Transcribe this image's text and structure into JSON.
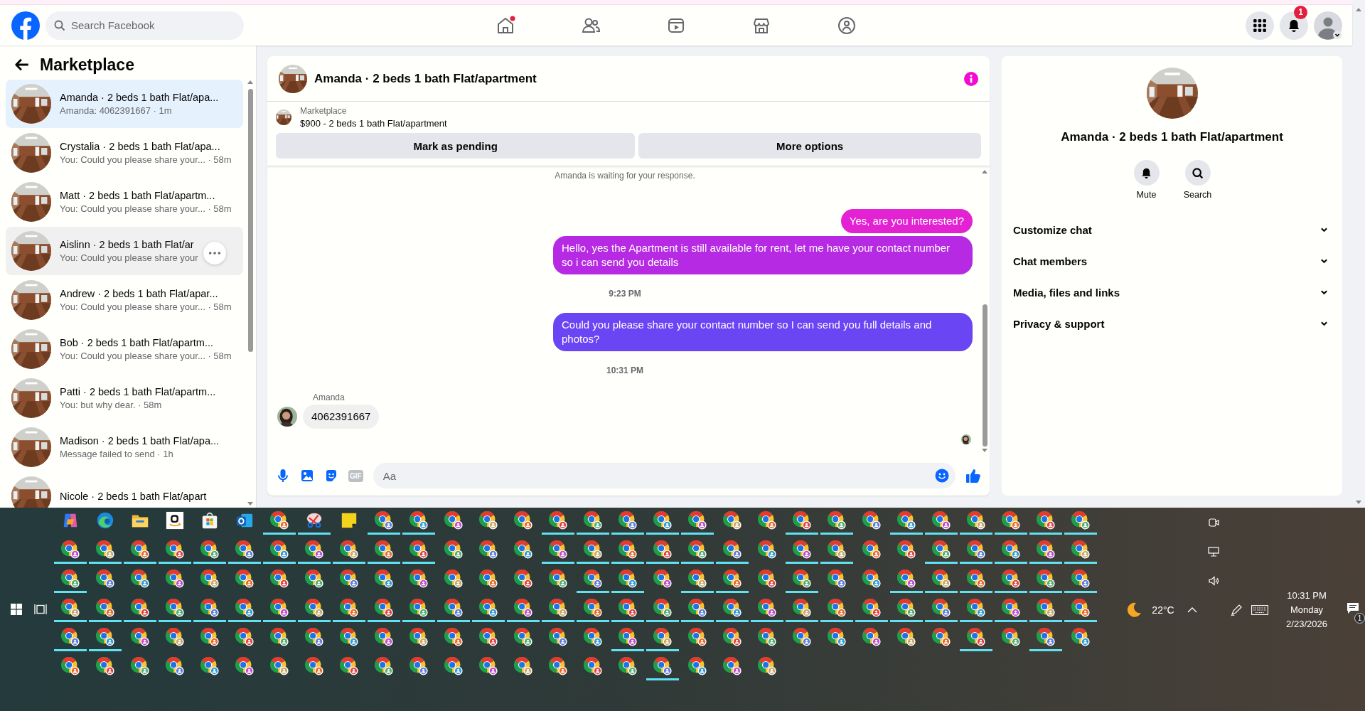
{
  "top_bar": {
    "search": {
      "placeholder": "Search Facebook"
    },
    "notification_badge": "1"
  },
  "sidebar": {
    "title": "Marketplace",
    "conversations": [
      {
        "title": "Amanda · 2 beds 1 bath Flat/apa...",
        "subtitle": "Amanda: 4062391667 · 1m",
        "selected": true,
        "hovered": false
      },
      {
        "title": "Crystalia · 2 beds 1 bath Flat/apa...",
        "subtitle": "You: Could you please share your... · 58m",
        "selected": false,
        "hovered": false
      },
      {
        "title": "Matt · 2 beds 1 bath Flat/apartm...",
        "subtitle": "You: Could you please share your... · 58m",
        "selected": false,
        "hovered": false
      },
      {
        "title": "Aislinn · 2 beds 1 bath Flat/ar",
        "subtitle": "You: Could you please share your",
        "selected": false,
        "hovered": true
      },
      {
        "title": "Andrew · 2 beds 1 bath Flat/apar...",
        "subtitle": "You: Could you please share your... · 58m",
        "selected": false,
        "hovered": false
      },
      {
        "title": "Bob · 2 beds 1 bath Flat/apartm...",
        "subtitle": "You: Could you please share your... · 58m",
        "selected": false,
        "hovered": false
      },
      {
        "title": "Patti · 2 beds 1 bath Flat/apartm...",
        "subtitle": "You: but why dear. · 58m",
        "selected": false,
        "hovered": false
      },
      {
        "title": "Madison · 2 beds 1 bath Flat/apa...",
        "subtitle": "Message failed to send · 1h",
        "selected": false,
        "hovered": false
      },
      {
        "title": "Nicole · 2 beds 1 bath Flat/apart",
        "selected": false,
        "hovered": false
      }
    ]
  },
  "chat": {
    "title": "Amanda · 2 beds 1 bath Flat/apartment",
    "listing": {
      "label": "Marketplace",
      "title": "$900 - 2 beds 1 bath Flat/apartment"
    },
    "buttons": [
      "Mark as pending",
      "More options"
    ],
    "messages": [
      {
        "kind": "system",
        "text": "Amanda is waiting for your response."
      },
      {
        "kind": "outgoing",
        "text": "Yes, are you interested?",
        "color": "#e322d3"
      },
      {
        "kind": "outgoing",
        "text": "Hello, yes the Apartment is still available for rent, let me have your contact number so i can send you details",
        "color": "#b72ae4"
      },
      {
        "kind": "time",
        "text": "9:23 PM"
      },
      {
        "kind": "outgoing",
        "text": "Could you please share your contact number so I can send you full details and photos?",
        "color": "#6945f4"
      },
      {
        "kind": "time",
        "text": "10:31 PM"
      },
      {
        "kind": "incoming",
        "sender": "Amanda",
        "text": "4062391667"
      }
    ],
    "composer": {
      "gif": "GIF",
      "placeholder": "Aa"
    }
  },
  "info": {
    "title": "Amanda · 2 beds 1 bath Flat/apartment",
    "actions": [
      {
        "kind": "bell",
        "label": "Mute"
      },
      {
        "kind": "search",
        "label": "Search"
      }
    ],
    "sections": [
      {
        "label": "Customize chat",
        "expanded": false
      },
      {
        "label": "Chat members",
        "expanded": false
      },
      {
        "label": "Media, files and links",
        "expanded": false
      },
      {
        "label": "Privacy & support",
        "expanded": false
      }
    ]
  },
  "taskbar": {
    "rows": [
      [
        {
          "kind": "copilot",
          "running": false
        },
        {
          "kind": "edge",
          "running": false
        },
        {
          "kind": "explorer",
          "running": false
        },
        {
          "kind": "amazon",
          "running": false
        },
        {
          "kind": "store",
          "running": false
        },
        {
          "kind": "outlook",
          "running": false
        },
        {
          "kind": "chrome",
          "running": true
        },
        {
          "kind": "snip",
          "running": true
        },
        {
          "kind": "notes",
          "running": false
        },
        {
          "kind": "chrome",
          "running": true
        },
        {
          "kind": "chrome",
          "running": true
        },
        {
          "kind": "chrome",
          "running": false
        },
        {
          "kind": "chrome",
          "running": false
        },
        {
          "kind": "chrome",
          "running": false
        },
        {
          "kind": "chrome",
          "running": true
        },
        {
          "kind": "chrome",
          "running": true
        },
        {
          "kind": "chrome",
          "running": true
        },
        {
          "kind": "chrome",
          "running": true
        },
        {
          "kind": "chrome",
          "running": true
        },
        {
          "kind": "chrome",
          "running": false
        },
        {
          "kind": "chrome",
          "running": false
        },
        {
          "kind": "chrome",
          "running": true
        },
        {
          "kind": "chrome",
          "running": true
        },
        {
          "kind": "chrome",
          "running": false
        },
        {
          "kind": "chrome",
          "running": true
        },
        {
          "kind": "chrome",
          "running": true
        },
        {
          "kind": "chrome",
          "running": true
        },
        {
          "kind": "chrome",
          "running": true
        },
        {
          "kind": "chrome",
          "running": true
        },
        {
          "kind": "chrome",
          "running": true
        }
      ],
      [
        {
          "kind": "chrome",
          "running": true
        },
        {
          "kind": "chrome",
          "running": true
        },
        {
          "kind": "chrome",
          "running": true
        },
        {
          "kind": "chrome",
          "running": true
        },
        {
          "kind": "chrome",
          "running": true
        },
        {
          "kind": "chrome",
          "running": true
        },
        {
          "kind": "chrome",
          "running": true
        },
        {
          "kind": "chrome",
          "running": true
        },
        {
          "kind": "chrome",
          "running": true
        },
        {
          "kind": "chrome",
          "running": true
        },
        {
          "kind": "chrome",
          "running": true
        },
        {
          "kind": "chrome",
          "running": false
        },
        {
          "kind": "chrome",
          "running": false
        },
        {
          "kind": "chrome",
          "running": false
        },
        {
          "kind": "chrome",
          "running": true
        },
        {
          "kind": "chrome",
          "running": true
        },
        {
          "kind": "chrome",
          "running": true
        },
        {
          "kind": "chrome",
          "running": true
        },
        {
          "kind": "chrome",
          "running": true
        },
        {
          "kind": "chrome",
          "running": true
        },
        {
          "kind": "chrome",
          "running": false
        },
        {
          "kind": "chrome",
          "running": true
        },
        {
          "kind": "chrome",
          "running": true
        },
        {
          "kind": "chrome",
          "running": false
        },
        {
          "kind": "chrome",
          "running": false
        },
        {
          "kind": "chrome",
          "running": true
        },
        {
          "kind": "chrome",
          "running": true
        },
        {
          "kind": "chrome",
          "running": true
        },
        {
          "kind": "chrome",
          "running": true
        },
        {
          "kind": "chrome",
          "running": true
        }
      ],
      [
        {
          "kind": "chrome",
          "running": true
        },
        {
          "kind": "chrome",
          "running": false
        },
        {
          "kind": "chrome",
          "running": false
        },
        {
          "kind": "chrome",
          "running": false
        },
        {
          "kind": "chrome",
          "running": false
        },
        {
          "kind": "chrome",
          "running": false
        },
        {
          "kind": "chrome",
          "running": false
        },
        {
          "kind": "chrome",
          "running": false
        },
        {
          "kind": "chrome",
          "running": false
        },
        {
          "kind": "chrome",
          "running": false
        },
        {
          "kind": "chrome",
          "running": false
        },
        {
          "kind": "chrome",
          "running": false
        },
        {
          "kind": "chrome",
          "running": false
        },
        {
          "kind": "chrome",
          "running": false
        },
        {
          "kind": "chrome",
          "running": false
        },
        {
          "kind": "chrome",
          "running": true
        },
        {
          "kind": "chrome",
          "running": true
        },
        {
          "kind": "chrome",
          "running": false
        },
        {
          "kind": "chrome",
          "running": true
        },
        {
          "kind": "chrome",
          "running": true
        },
        {
          "kind": "chrome",
          "running": false
        },
        {
          "kind": "chrome",
          "running": true
        },
        {
          "kind": "chrome",
          "running": false
        },
        {
          "kind": "chrome",
          "running": false
        },
        {
          "kind": "chrome",
          "running": true
        },
        {
          "kind": "chrome",
          "running": true
        },
        {
          "kind": "chrome",
          "running": true
        },
        {
          "kind": "chrome",
          "running": true
        },
        {
          "kind": "chrome",
          "running": true
        },
        {
          "kind": "chrome",
          "running": true
        }
      ],
      [
        {
          "kind": "chrome",
          "running": true
        },
        {
          "kind": "chrome",
          "running": true
        },
        {
          "kind": "chrome",
          "running": true
        },
        {
          "kind": "chrome",
          "running": true
        },
        {
          "kind": "chrome",
          "running": true
        },
        {
          "kind": "chrome",
          "running": true
        },
        {
          "kind": "chrome",
          "running": true
        },
        {
          "kind": "chrome",
          "running": true
        },
        {
          "kind": "chrome",
          "running": true
        },
        {
          "kind": "chrome",
          "running": true
        },
        {
          "kind": "chrome",
          "running": true
        },
        {
          "kind": "chrome",
          "running": true
        },
        {
          "kind": "chrome",
          "running": true
        },
        {
          "kind": "chrome",
          "running": true
        },
        {
          "kind": "chrome",
          "running": true
        },
        {
          "kind": "chrome",
          "running": true
        },
        {
          "kind": "chrome",
          "running": true
        },
        {
          "kind": "chrome",
          "running": true
        },
        {
          "kind": "chrome",
          "running": true
        },
        {
          "kind": "chrome",
          "running": true
        },
        {
          "kind": "chrome",
          "running": true
        },
        {
          "kind": "chrome",
          "running": true
        },
        {
          "kind": "chrome",
          "running": true
        },
        {
          "kind": "chrome",
          "running": true
        },
        {
          "kind": "chrome",
          "running": true
        },
        {
          "kind": "chrome",
          "running": true
        },
        {
          "kind": "chrome",
          "running": true
        },
        {
          "kind": "chrome",
          "running": true
        },
        {
          "kind": "chrome",
          "running": true
        },
        {
          "kind": "chrome",
          "running": true
        }
      ],
      [
        {
          "kind": "chrome",
          "running": true
        },
        {
          "kind": "chrome",
          "running": true
        },
        {
          "kind": "chrome",
          "running": false
        },
        {
          "kind": "chrome",
          "running": false
        },
        {
          "kind": "chrome",
          "running": false
        },
        {
          "kind": "chrome",
          "running": false
        },
        {
          "kind": "chrome",
          "running": false
        },
        {
          "kind": "chrome",
          "running": false
        },
        {
          "kind": "chrome",
          "running": false
        },
        {
          "kind": "chrome",
          "running": false
        },
        {
          "kind": "chrome",
          "running": false
        },
        {
          "kind": "chrome",
          "running": false
        },
        {
          "kind": "chrome",
          "running": false
        },
        {
          "kind": "chrome",
          "running": false
        },
        {
          "kind": "chrome",
          "running": false
        },
        {
          "kind": "chrome",
          "running": false
        },
        {
          "kind": "chrome",
          "running": true
        },
        {
          "kind": "chrome",
          "running": true
        },
        {
          "kind": "chrome",
          "running": false
        },
        {
          "kind": "chrome",
          "running": false
        },
        {
          "kind": "chrome",
          "running": false
        },
        {
          "kind": "chrome",
          "running": false
        },
        {
          "kind": "chrome",
          "running": false
        },
        {
          "kind": "chrome",
          "running": false
        },
        {
          "kind": "chrome",
          "running": false
        },
        {
          "kind": "chrome",
          "running": false
        },
        {
          "kind": "chrome",
          "running": true
        },
        {
          "kind": "chrome",
          "running": false
        },
        {
          "kind": "chrome",
          "running": true
        },
        {
          "kind": "chrome",
          "running": false
        }
      ],
      [
        {
          "kind": "chrome",
          "running": false
        },
        {
          "kind": "chrome",
          "running": false
        },
        {
          "kind": "chrome",
          "running": false
        },
        {
          "kind": "chrome",
          "running": false
        },
        {
          "kind": "chrome",
          "running": false
        },
        {
          "kind": "chrome",
          "running": false
        },
        {
          "kind": "chrome",
          "running": false
        },
        {
          "kind": "chrome",
          "running": false
        },
        {
          "kind": "chrome",
          "running": false
        },
        {
          "kind": "chrome",
          "running": false
        },
        {
          "kind": "chrome",
          "running": false
        },
        {
          "kind": "chrome",
          "running": false
        },
        {
          "kind": "chrome",
          "running": false
        },
        {
          "kind": "chrome",
          "running": false
        },
        {
          "kind": "chrome",
          "running": false
        },
        {
          "kind": "chrome",
          "running": false
        },
        {
          "kind": "chrome",
          "running": false
        },
        {
          "kind": "chrome",
          "running": true
        },
        {
          "kind": "chrome",
          "running": false
        },
        {
          "kind": "chrome",
          "running": false
        },
        {
          "kind": "chrome",
          "running": false
        }
      ]
    ],
    "tray": {
      "weather": "22°C",
      "time": "10:31 PM",
      "day": "Monday",
      "date": "2/23/2026",
      "notification_badge": "1"
    }
  }
}
